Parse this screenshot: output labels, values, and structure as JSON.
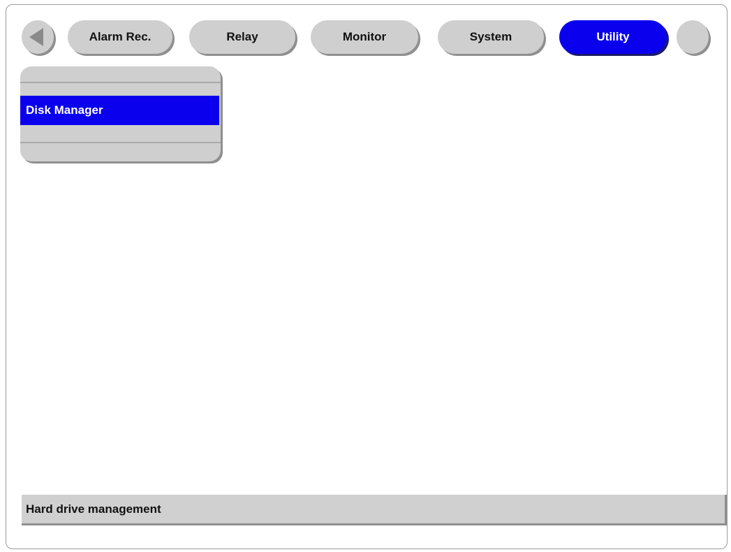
{
  "nav": {
    "tabs": [
      {
        "label": "Alarm Rec.",
        "active": false
      },
      {
        "label": "Relay",
        "active": false
      },
      {
        "label": "Monitor",
        "active": false
      },
      {
        "label": "System",
        "active": false
      },
      {
        "label": "Utility",
        "active": true
      }
    ],
    "back_icon": "left-triangle-arrow",
    "next_icon": "blank-circle"
  },
  "menu": {
    "items": [
      {
        "label": "Disk Manager",
        "selected": true
      }
    ]
  },
  "status": {
    "text": "Hard drive management"
  },
  "colors": {
    "active": "#0a00ee",
    "inactive": "#cfcfcf"
  }
}
